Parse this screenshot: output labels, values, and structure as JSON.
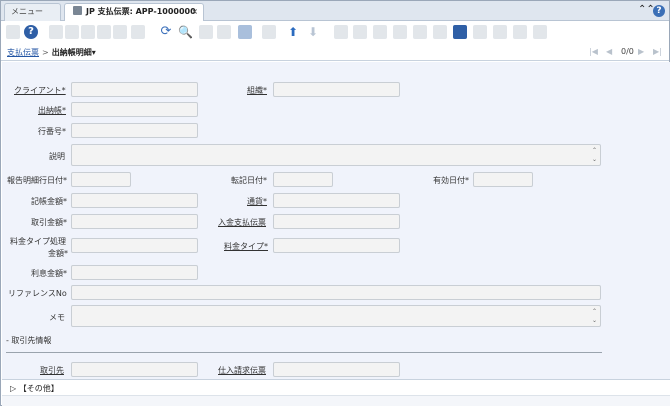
{
  "tabs": {
    "menu_label": "メニュー (8)",
    "active_label": "JP 支払伝票: APP-1000000",
    "close": "×"
  },
  "window_controls": {
    "collapse": "⌃⌃",
    "help": "?"
  },
  "toolbar": {
    "refresh": "⟳",
    "search": "🔍",
    "up": "⬆",
    "down": "⬇",
    "help": "?"
  },
  "breadcrumb": {
    "parent": "支払伝票",
    "separator": ">",
    "current": "出納帳明細▾",
    "record_count": "0/0",
    "nav_first": "|◀",
    "nav_prev": "◀",
    "nav_next": "▶",
    "nav_last": "▶|"
  },
  "form": {
    "client_label": "クライアント*",
    "org_label": "組織*",
    "cashbook_label": "出納帳*",
    "line_no_label": "行番号*",
    "description_label": "説明",
    "statement_date_label": "報告明細行日付*",
    "posting_date_label": "転記日付*",
    "effective_date_label": "有効日付*",
    "statement_amount_label": "記帳金額*",
    "currency_label": "通貨*",
    "trx_amount_label": "取引金額*",
    "receipt_label": "入金支払伝票",
    "charge_type_label_1": "料金タイプ処理",
    "charge_type_label_2": "金額*",
    "charge_type_link": "料金タイプ*",
    "interest_label": "利息金額*",
    "reference_label": "リファレンスNo",
    "memo_label": "メモ",
    "partner_section": "- 取引先情報",
    "partner_label": "取引先",
    "invoice_label": "仕入請求伝票"
  },
  "footer": {
    "other_section": "▷ 【その他】"
  }
}
